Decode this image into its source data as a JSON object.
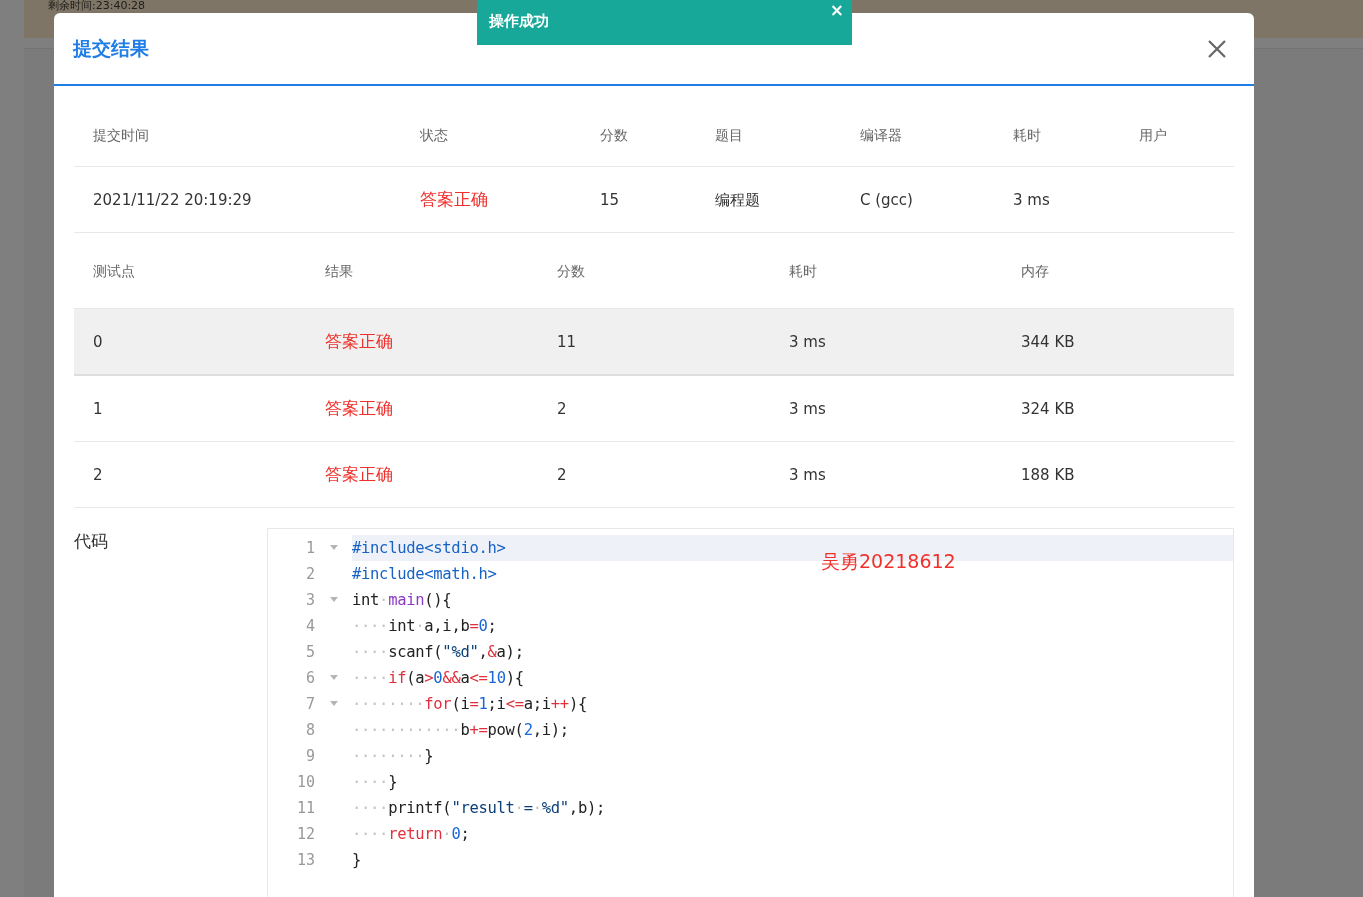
{
  "background": {
    "timer": "剩余时间:23:40:28"
  },
  "toast": {
    "message": "操作成功",
    "close": "×"
  },
  "dialog": {
    "title": "提交结果",
    "summary": {
      "columns": [
        "提交时间",
        "状态",
        "分数",
        "题目",
        "编译器",
        "耗时",
        "用户"
      ],
      "row": [
        "2021/11/22 20:19:29",
        "答案正确",
        "15",
        "编程题",
        "C (gcc)",
        "3 ms"
      ]
    },
    "tests": {
      "columns": [
        "测试点",
        "结果",
        "分数",
        "耗时",
        "内存"
      ],
      "rows": [
        {
          "highlighted": true,
          "cells": [
            "0",
            "答案正确",
            "11",
            "3 ms",
            "344 KB"
          ]
        },
        {
          "highlighted": false,
          "cells": [
            "1",
            "答案正确",
            "2",
            "3 ms",
            "324 KB"
          ]
        },
        {
          "highlighted": false,
          "cells": [
            "2",
            "答案正确",
            "2",
            "3 ms",
            "188 KB"
          ]
        }
      ]
    },
    "code": {
      "label": "代码",
      "annotation": "吴勇20218612",
      "lines": [
        {
          "number": "1",
          "foldable": true,
          "active": true,
          "tokens": [
            {
              "kind": "meta",
              "text": "#include<stdio.h>"
            }
          ]
        },
        {
          "number": "2",
          "foldable": false,
          "active": false,
          "tokens": [
            {
              "kind": "meta",
              "text": "#include<math.h>"
            }
          ]
        },
        {
          "number": "3",
          "foldable": true,
          "active": false,
          "tokens": [
            {
              "kind": "plain",
              "text": "int"
            },
            {
              "kind": "ws",
              "text": "·"
            },
            {
              "kind": "func",
              "text": "main"
            },
            {
              "kind": "plain",
              "text": "(){"
            }
          ]
        },
        {
          "number": "4",
          "foldable": false,
          "active": false,
          "tokens": [
            {
              "kind": "ws",
              "text": "····"
            },
            {
              "kind": "plain",
              "text": "int"
            },
            {
              "kind": "ws",
              "text": "·"
            },
            {
              "kind": "plain",
              "text": "a,i,b"
            },
            {
              "kind": "op",
              "text": "="
            },
            {
              "kind": "num",
              "text": "0"
            },
            {
              "kind": "plain",
              "text": ";"
            }
          ]
        },
        {
          "number": "5",
          "foldable": false,
          "active": false,
          "tokens": [
            {
              "kind": "ws",
              "text": "····"
            },
            {
              "kind": "plain",
              "text": "scanf("
            },
            {
              "kind": "str",
              "text": "\"%d\""
            },
            {
              "kind": "plain",
              "text": ","
            },
            {
              "kind": "op",
              "text": "&"
            },
            {
              "kind": "plain",
              "text": "a);"
            }
          ]
        },
        {
          "number": "6",
          "foldable": true,
          "active": false,
          "tokens": [
            {
              "kind": "ws",
              "text": "····"
            },
            {
              "kind": "kw",
              "text": "if"
            },
            {
              "kind": "plain",
              "text": "(a"
            },
            {
              "kind": "op",
              "text": ">"
            },
            {
              "kind": "num",
              "text": "0"
            },
            {
              "kind": "op",
              "text": "&&"
            },
            {
              "kind": "plain",
              "text": "a"
            },
            {
              "kind": "op",
              "text": "<="
            },
            {
              "kind": "num",
              "text": "10"
            },
            {
              "kind": "plain",
              "text": "){"
            }
          ]
        },
        {
          "number": "7",
          "foldable": true,
          "active": false,
          "tokens": [
            {
              "kind": "ws",
              "text": "········"
            },
            {
              "kind": "kw",
              "text": "for"
            },
            {
              "kind": "plain",
              "text": "(i"
            },
            {
              "kind": "op",
              "text": "="
            },
            {
              "kind": "num",
              "text": "1"
            },
            {
              "kind": "plain",
              "text": ";i"
            },
            {
              "kind": "op",
              "text": "<="
            },
            {
              "kind": "plain",
              "text": "a;i"
            },
            {
              "kind": "op",
              "text": "++"
            },
            {
              "kind": "plain",
              "text": "){"
            }
          ]
        },
        {
          "number": "8",
          "foldable": false,
          "active": false,
          "tokens": [
            {
              "kind": "ws",
              "text": "············"
            },
            {
              "kind": "plain",
              "text": "b"
            },
            {
              "kind": "op",
              "text": "+="
            },
            {
              "kind": "plain",
              "text": "pow("
            },
            {
              "kind": "num",
              "text": "2"
            },
            {
              "kind": "plain",
              "text": ",i);"
            }
          ]
        },
        {
          "number": "9",
          "foldable": false,
          "active": false,
          "tokens": [
            {
              "kind": "ws",
              "text": "········"
            },
            {
              "kind": "plain",
              "text": "}"
            }
          ]
        },
        {
          "number": "10",
          "foldable": false,
          "active": false,
          "tokens": [
            {
              "kind": "ws",
              "text": "····"
            },
            {
              "kind": "plain",
              "text": "}"
            }
          ]
        },
        {
          "number": "11",
          "foldable": false,
          "active": false,
          "tokens": [
            {
              "kind": "ws",
              "text": "····"
            },
            {
              "kind": "plain",
              "text": "printf("
            },
            {
              "kind": "str",
              "text": "\"result"
            },
            {
              "kind": "ws",
              "text": "·"
            },
            {
              "kind": "str",
              "text": "="
            },
            {
              "kind": "ws",
              "text": "·"
            },
            {
              "kind": "str",
              "text": "%d\""
            },
            {
              "kind": "plain",
              "text": ",b);"
            }
          ]
        },
        {
          "number": "12",
          "foldable": false,
          "active": false,
          "tokens": [
            {
              "kind": "ws",
              "text": "····"
            },
            {
              "kind": "kw",
              "text": "return"
            },
            {
              "kind": "ws",
              "text": "·"
            },
            {
              "kind": "num",
              "text": "0"
            },
            {
              "kind": "plain",
              "text": ";"
            }
          ]
        },
        {
          "number": "13",
          "foldable": false,
          "active": false,
          "tokens": [
            {
              "kind": "plain",
              "text": "}"
            }
          ]
        }
      ]
    }
  }
}
